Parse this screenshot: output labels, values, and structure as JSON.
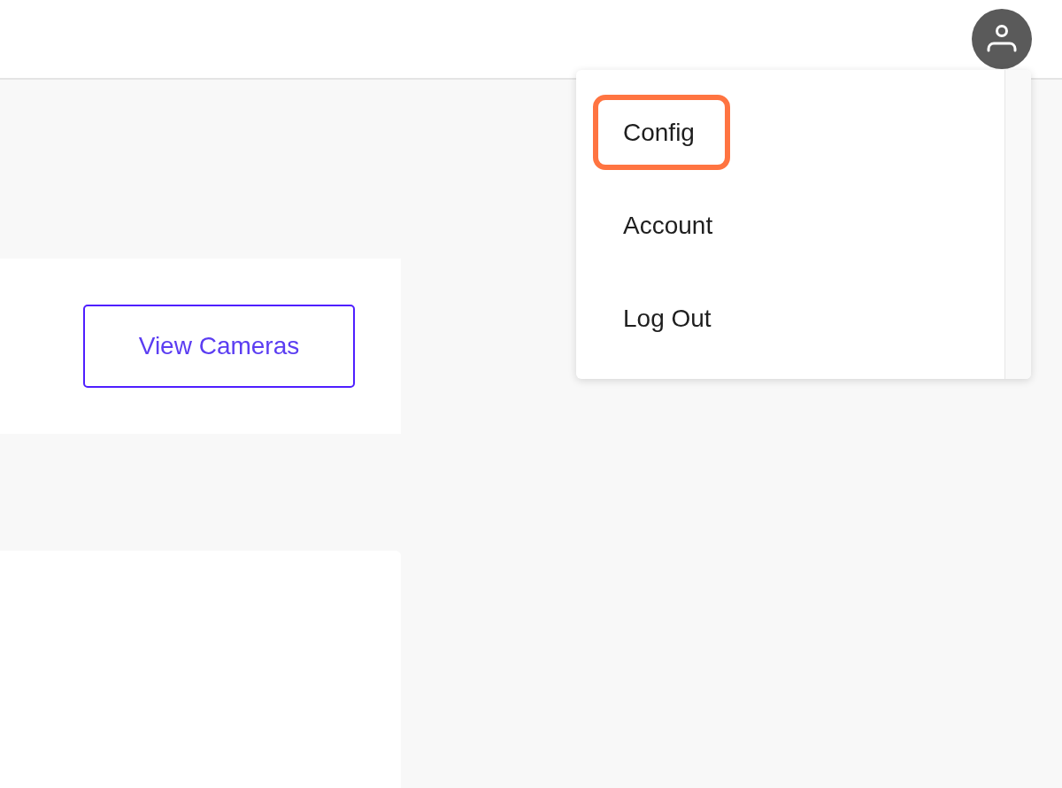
{
  "header": {
    "account_menu": {
      "open": true,
      "items": [
        {
          "label": "Config",
          "highlighted": true
        },
        {
          "label": "Account",
          "highlighted": false
        },
        {
          "label": "Log Out",
          "highlighted": false
        }
      ]
    }
  },
  "camera_card": {
    "button": "View Cameras"
  }
}
